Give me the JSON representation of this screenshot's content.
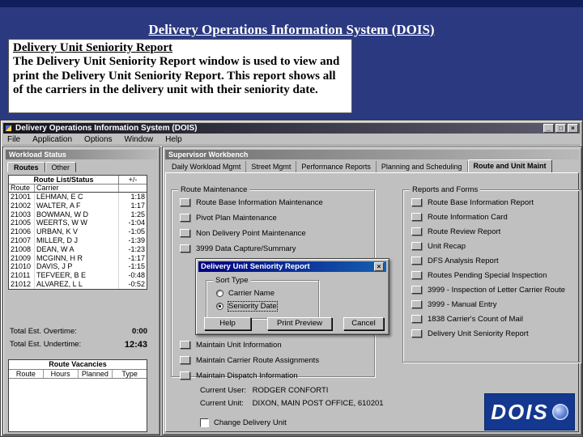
{
  "slide": {
    "title": "Delivery Operations Information System (DOIS)",
    "info_heading": "Delivery Unit Seniority Report",
    "info_body": "The Delivery Unit Seniority Report window is used to view and print the Delivery Unit Seniority Report.  This report shows all of the carriers in the delivery unit with their seniority date."
  },
  "app": {
    "title": "Delivery Operations Information System (DOIS)",
    "window_buttons": {
      "minimize": "_",
      "maximize": "□",
      "close": "×"
    },
    "menu": [
      "File",
      "Application",
      "Options",
      "Window",
      "Help"
    ],
    "workload": {
      "title": "Workload Status",
      "tabs": [
        "Routes",
        "Other"
      ],
      "header_group": "Route List/Status",
      "header_delta": "+/-",
      "col_route": "Route",
      "col_carrier": "Carrier",
      "rows": [
        [
          "21001",
          "LEHMAN, E C",
          "1:18"
        ],
        [
          "21002",
          "WALTER, A F",
          "1:17"
        ],
        [
          "21003",
          "BOWMAN, W D",
          "1:25"
        ],
        [
          "21005",
          "WEERTS, W W",
          "-1:04"
        ],
        [
          "21006",
          "URBAN, K V",
          "-1:05"
        ],
        [
          "21007",
          "MILLER, D J",
          "-1:39"
        ],
        [
          "21008",
          "DEAN, W A",
          "-1:23"
        ],
        [
          "21009",
          "MCGINN, H R",
          "-1:17"
        ],
        [
          "21010",
          "DAVIS, J P",
          "-1:15"
        ],
        [
          "21011",
          "TEFVEER, B E",
          "-0:48"
        ],
        [
          "21012",
          "ALVAREZ, L L",
          "-0:52"
        ]
      ],
      "overtime_label": "Total Est. Overtime:",
      "overtime_value": "0:00",
      "undertime_label": "Total Est. Undertime:",
      "undertime_value": "12:43",
      "vacancies_title": "Route Vacancies",
      "vacancies_columns": [
        "Route",
        "Hours",
        "Planned",
        "Type"
      ]
    },
    "workbench": {
      "title": "Supervisor Workbench",
      "tabs": [
        "Daily Workload Mgmt",
        "Street Mgmt",
        "Performance Reports",
        "Planning and Scheduling",
        "Route and Unit Maint"
      ],
      "route_maintenance": {
        "label": "Route Maintenance",
        "items": [
          "Route Base Information Maintenance",
          "Pivot Plan Maintenance",
          "Non Delivery Point Maintenance",
          "3999 Data Capture/Summary"
        ],
        "unit_items": [
          "Maintain Unit Information",
          "Maintain Carrier Route Assignments",
          "Maintain Dispatch Information"
        ]
      },
      "reports": {
        "label": "Reports and Forms",
        "items": [
          "Route Base Information Report",
          "Route Information Card",
          "Route Review Report",
          "Unit Recap",
          "DFS Analysis Report",
          "Routes Pending Special Inspection",
          "3999 - Inspection of Letter Carrier Route",
          "3999 - Manual Entry",
          "1838 Carrier's Count of Mail",
          "Delivery Unit Seniority Report"
        ]
      },
      "current_user_label": "Current User:",
      "current_user_value": "RODGER CONFORTI",
      "current_unit_label": "Current Unit:",
      "current_unit_value": "DIXON, MAIN POST OFFICE, 610201",
      "change_unit_label": "Change Delivery Unit",
      "logo_text": "DOIS"
    },
    "dialog": {
      "title": "Delivery Unit Seniority Report",
      "close": "×",
      "sort_group_label": "Sort Type",
      "radio_options": [
        "Carrier Name",
        "Seniority Date"
      ],
      "selected_option": "Seniority Date",
      "buttons": [
        "Help",
        "Print Preview",
        "Cancel"
      ]
    }
  }
}
